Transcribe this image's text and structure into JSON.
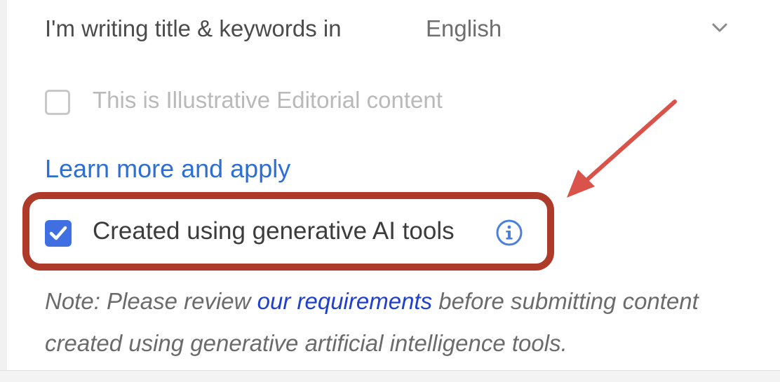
{
  "language_row": {
    "label": "I'm writing title & keywords in",
    "selected_language": "English",
    "dropdown_icon": "chevron-down-icon"
  },
  "editorial": {
    "label": "This is Illustrative Editorial content",
    "checked": false,
    "disabled": true
  },
  "learn_more": {
    "label": "Learn more and apply"
  },
  "genai": {
    "label": "Created using generative AI tools",
    "checked": true,
    "info_icon": "info-icon"
  },
  "note": {
    "prefix": "Note: Please review ",
    "link_text": "our requirements",
    "suffix": " before submitting content created using generative artificial intelligence tools."
  },
  "annotation": {
    "highlight_color": "#ae3a2a",
    "arrow_color": "#d9534a"
  },
  "colors": {
    "link": "#2d6fd2",
    "checkbox_accent": "#3f6fe0",
    "note_link": "#1f3fcf"
  }
}
